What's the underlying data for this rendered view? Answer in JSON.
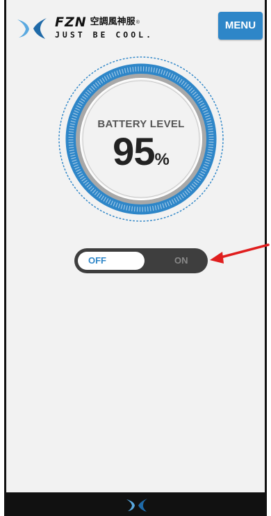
{
  "header": {
    "brand_name": "FZN",
    "brand_cn": "空調風神服",
    "brand_reg": "®",
    "tagline": "JUST BE COOL.",
    "menu_label": "MENU",
    "logo_icon": "fzn-wing-logo-icon"
  },
  "battery": {
    "label": "BATTERY LEVEL",
    "value": "95",
    "unit": "%",
    "level_fraction": 0.95
  },
  "power_toggle": {
    "off_label": "OFF",
    "on_label": "ON",
    "state": "off"
  },
  "footer": {
    "logo_icon": "fzn-wing-logo-icon"
  },
  "annotation": {
    "arrow_icon": "red-arrow-icon",
    "arrow_color": "#e01e1e"
  },
  "colors": {
    "accent": "#2e86c8",
    "toggle_bg": "#3e3e3e",
    "footer_bg": "#111111",
    "background": "#f2f2f2"
  }
}
